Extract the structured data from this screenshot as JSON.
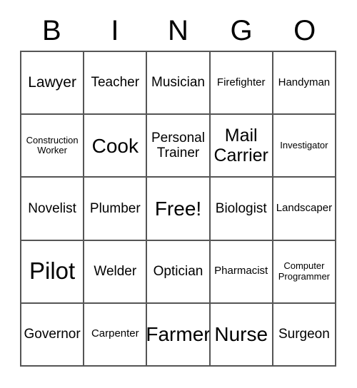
{
  "title": "BINGO Card",
  "colors": {
    "background": "#ffffff",
    "text": "#000000",
    "grid_line": "#555555"
  },
  "header": {
    "letters": [
      "B",
      "I",
      "N",
      "G",
      "O"
    ]
  },
  "grid": {
    "columns": 5,
    "rows": 5,
    "cells": [
      [
        {
          "text": "Lawyer",
          "size": "lg"
        },
        {
          "text": "Teacher",
          "size": "md"
        },
        {
          "text": "Musician",
          "size": "md"
        },
        {
          "text": "Firefighter",
          "size": "sm"
        },
        {
          "text": "Handyman",
          "size": "sm"
        }
      ],
      [
        {
          "text": "Construction\nWorker",
          "size": "xs"
        },
        {
          "text": "Cook",
          "size": "xxl"
        },
        {
          "text": "Personal\nTrainer",
          "size": "md"
        },
        {
          "text": "Mail\nCarrier",
          "size": "xl"
        },
        {
          "text": "Investigator",
          "size": "xs"
        }
      ],
      [
        {
          "text": "Novelist",
          "size": "md"
        },
        {
          "text": "Plumber",
          "size": "md"
        },
        {
          "text": "Free!",
          "size": "xxl"
        },
        {
          "text": "Biologist",
          "size": "md"
        },
        {
          "text": "Landscaper",
          "size": "sm"
        }
      ],
      [
        {
          "text": "Pilot",
          "size": "huge"
        },
        {
          "text": "Welder",
          "size": "md"
        },
        {
          "text": "Optician",
          "size": "md"
        },
        {
          "text": "Pharmacist",
          "size": "sm"
        },
        {
          "text": "Computer\nProgrammer",
          "size": "xs"
        }
      ],
      [
        {
          "text": "Governor",
          "size": "md"
        },
        {
          "text": "Carpenter",
          "size": "sm"
        },
        {
          "text": "Farmer",
          "size": "xxl"
        },
        {
          "text": "Nurse",
          "size": "xxl"
        },
        {
          "text": "Surgeon",
          "size": "md"
        }
      ]
    ]
  }
}
